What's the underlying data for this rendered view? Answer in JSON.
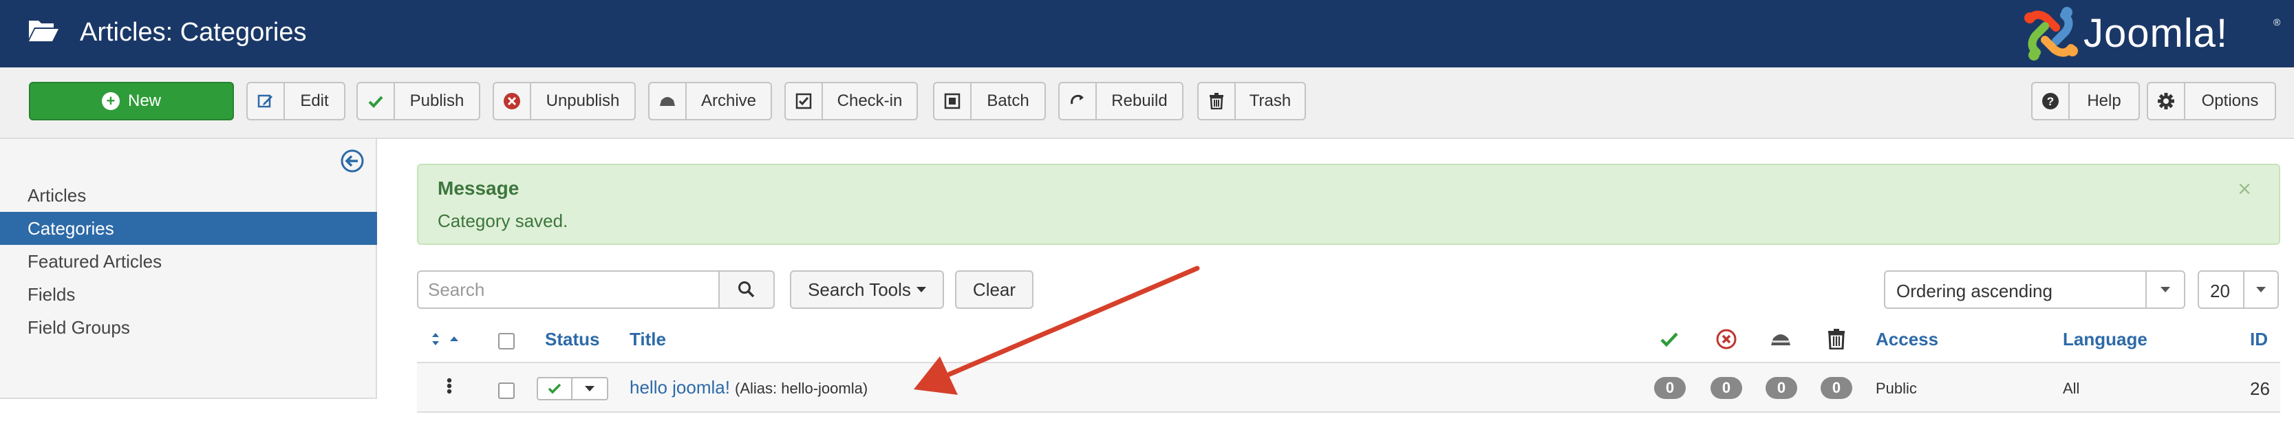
{
  "header": {
    "title": "Articles: Categories",
    "brand": "Joomla!",
    "registered_mark": "®"
  },
  "toolbar": {
    "new": "New",
    "edit": "Edit",
    "publish": "Publish",
    "unpublish": "Unpublish",
    "archive": "Archive",
    "checkin": "Check-in",
    "batch": "Batch",
    "rebuild": "Rebuild",
    "trash": "Trash",
    "help": "Help",
    "options": "Options"
  },
  "sidebar": {
    "items": [
      {
        "label": "Articles",
        "active": false
      },
      {
        "label": "Categories",
        "active": true
      },
      {
        "label": "Featured Articles",
        "active": false
      },
      {
        "label": "Fields",
        "active": false
      },
      {
        "label": "Field Groups",
        "active": false
      }
    ]
  },
  "message": {
    "heading": "Message",
    "body": "Category saved.",
    "close": "×"
  },
  "filters": {
    "search_placeholder": "Search",
    "search_tools": "Search Tools",
    "clear": "Clear",
    "ordering": "Ordering ascending",
    "limit": "20"
  },
  "table": {
    "headers": {
      "status": "Status",
      "title": "Title",
      "access": "Access",
      "language": "Language",
      "id": "ID"
    },
    "rows": [
      {
        "title": "hello joomla!",
        "alias": "(Alias: hello-joomla)",
        "published": "0",
        "unpublished": "0",
        "archived": "0",
        "trashed": "0",
        "access": "Public",
        "language": "All",
        "id": "26"
      }
    ]
  },
  "colors": {
    "header": "#1a3867",
    "accent": "#2d6aa8",
    "success": "#2f9c3a",
    "danger": "#bd362f",
    "annotation": "#d6402b"
  }
}
